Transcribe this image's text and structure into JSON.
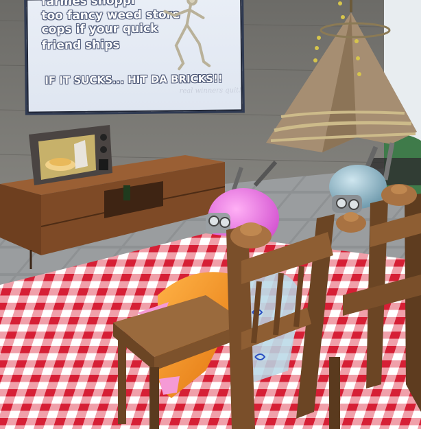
{
  "poster": {
    "lines": [
      "farmes shoppi",
      "too fancy weed store",
      "cops if your quick",
      "friend ships"
    ],
    "slogan": "IF IT SUCKS... HIT DA BRICKS!!",
    "signature": "real winners quit!"
  },
  "colors": {
    "wall": "#7a7975",
    "floor": "#8b8d8e",
    "tablecloth_red": "#e0233a",
    "tablecloth_white": "#ffffff",
    "wood": "#8a5a32",
    "pink_avatar": "#e86fe0",
    "blue_avatar": "#8fb6c7",
    "orange_avatar": "#f08a12"
  }
}
